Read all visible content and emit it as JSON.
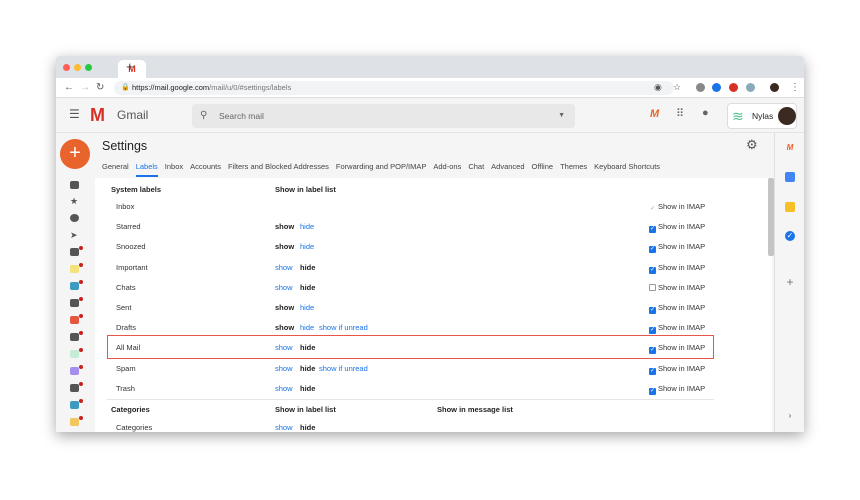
{
  "browser": {
    "tab_icon": "M",
    "url_host": "https://mail.google.com",
    "url_path": "/mail/u/0/#settings/labels",
    "new_tab": "+"
  },
  "header": {
    "app_name": "Gmail",
    "search_placeholder": "Search mail",
    "account_name": "Nylas"
  },
  "settings": {
    "title": "Settings",
    "tabs": [
      "General",
      "Labels",
      "Inbox",
      "Accounts",
      "Filters and Blocked Addresses",
      "Forwarding and POP/IMAP",
      "Add-ons",
      "Chat",
      "Advanced",
      "Offline",
      "Themes",
      "Keyboard Shortcuts"
    ],
    "active_tab": "Labels",
    "system_header": "System labels",
    "list_header": "Show in label list",
    "show": "show",
    "hide": "hide",
    "show_if_unread": "show if unread",
    "imap_label": "Show in IMAP",
    "rows": [
      {
        "label": "Inbox",
        "state": "",
        "extra": false,
        "imap": "disabled"
      },
      {
        "label": "Starred",
        "state": "show",
        "extra": false,
        "imap": "checked"
      },
      {
        "label": "Snoozed",
        "state": "show",
        "extra": false,
        "imap": "checked"
      },
      {
        "label": "Important",
        "state": "hide",
        "extra": false,
        "imap": "checked"
      },
      {
        "label": "Chats",
        "state": "hide",
        "extra": false,
        "imap": "unchecked"
      },
      {
        "label": "Sent",
        "state": "show",
        "extra": false,
        "imap": "checked"
      },
      {
        "label": "Drafts",
        "state": "show",
        "extra": true,
        "imap": "checked"
      },
      {
        "label": "All Mail",
        "state": "hide",
        "extra": false,
        "imap": "checked"
      },
      {
        "label": "Spam",
        "state": "hide",
        "extra": true,
        "imap": "checked"
      },
      {
        "label": "Trash",
        "state": "hide",
        "extra": false,
        "imap": "checked"
      }
    ],
    "categories_header": "Categories",
    "categories_list_header": "Show in label list",
    "categories_msg_header": "Show in message list",
    "categories_row": {
      "label": "Categories",
      "state": "hide"
    }
  },
  "colors": {
    "accent": "#1a73e8",
    "highlight": "#e8564a",
    "compose": "#e8642c"
  }
}
